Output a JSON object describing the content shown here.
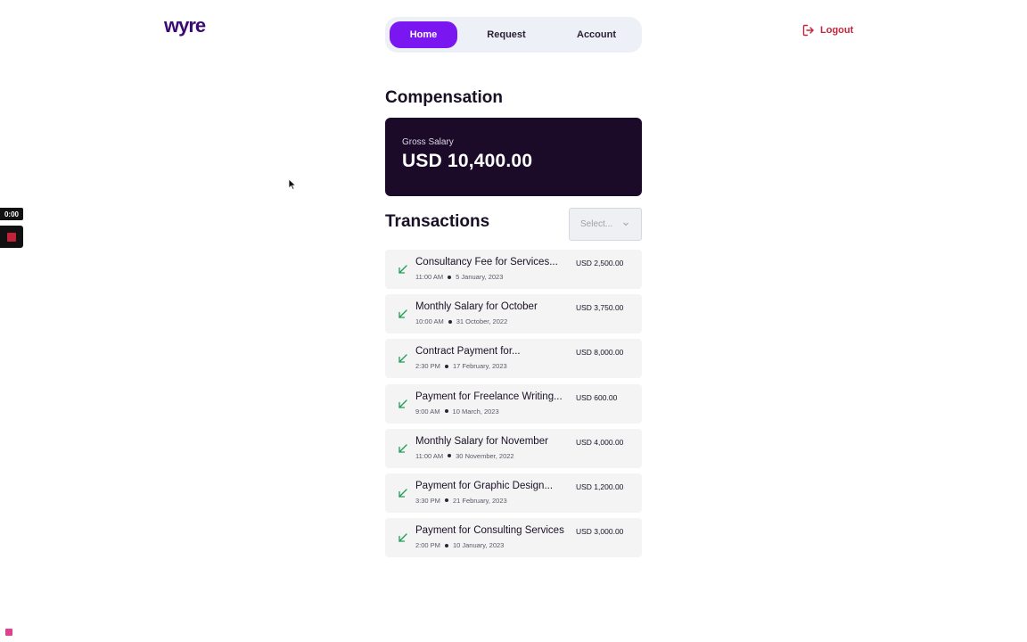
{
  "app": {
    "logo_text": "wyre",
    "brand_color": "#7a17f0"
  },
  "nav": {
    "items": [
      {
        "label": "Home",
        "active": true
      },
      {
        "label": "Request",
        "active": false
      },
      {
        "label": "Account",
        "active": false
      }
    ]
  },
  "header": {
    "logout_label": "Logout",
    "logout_icon": "logout-icon"
  },
  "compensation": {
    "title": "Compensation",
    "gross_label": "Gross Salary",
    "gross_amount": "USD 10,400.00"
  },
  "transactions": {
    "title": "Transactions",
    "filter_placeholder": "Select...",
    "items": [
      {
        "title": "Consultancy Fee for Services...",
        "time": "11:00 AM",
        "date": "5 January, 2023",
        "amount": "USD 2,500.00"
      },
      {
        "title": "Monthly Salary for October",
        "time": "10:00 AM",
        "date": "31 October, 2022",
        "amount": "USD 3,750.00"
      },
      {
        "title": "Contract Payment for...",
        "time": "2:30 PM",
        "date": "17 February, 2023",
        "amount": "USD 8,000.00"
      },
      {
        "title": "Payment for Freelance Writing...",
        "time": "9:00 AM",
        "date": "10 March, 2023",
        "amount": "USD 600.00"
      },
      {
        "title": "Monthly Salary for November",
        "time": "11:00 AM",
        "date": "30 November, 2022",
        "amount": "USD 4,000.00"
      },
      {
        "title": "Payment for Graphic Design...",
        "time": "3:30 PM",
        "date": "21 February, 2023",
        "amount": "USD 1,200.00"
      },
      {
        "title": "Payment for Consulting Services",
        "time": "2:00 PM",
        "date": "10 January, 2023",
        "amount": "USD 3,000.00"
      }
    ]
  },
  "recorder": {
    "timer": "0:00"
  }
}
